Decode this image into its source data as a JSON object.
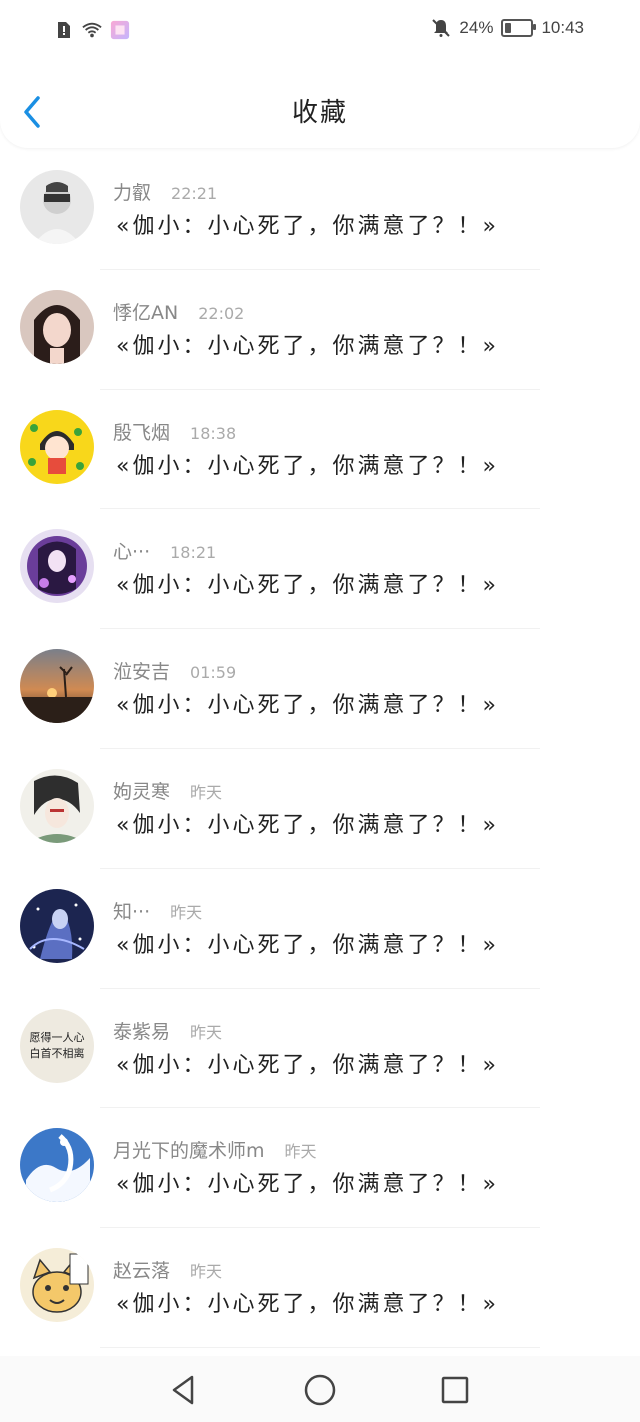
{
  "status_bar": {
    "battery_percent_text": "24%",
    "battery_level": 0.24,
    "time": "10:43",
    "icons": [
      "alert-icon",
      "wifi-icon",
      "app-icon",
      "mute-bell-icon",
      "battery-icon"
    ]
  },
  "header": {
    "title": "收藏",
    "back_icon": "chevron-left-icon"
  },
  "items": [
    {
      "name": "力叡",
      "time": "22:21",
      "message": "«伽小：小心死了，你满意了？！»",
      "avatar_theme": "bw-person"
    },
    {
      "name": "悸亿AN",
      "time": "22:02",
      "message": "«伽小：小心死了，你满意了？！»",
      "avatar_theme": "girl"
    },
    {
      "name": "殷飞烟",
      "time": "18:38",
      "message": "«伽小：小心死了，你满意了？！»",
      "avatar_theme": "yellow-cartoon"
    },
    {
      "name": "心···",
      "time": "18:21",
      "message": "«伽小：小心死了，你满意了？！»",
      "avatar_theme": "purple-anime"
    },
    {
      "name": "涖安吉",
      "time": "01:59",
      "message": "«伽小：小心死了，你满意了？！»",
      "avatar_theme": "sunset"
    },
    {
      "name": "姁灵寒",
      "time": "昨天",
      "message": "«伽小：小心死了，你满意了？！»",
      "avatar_theme": "ink-anime"
    },
    {
      "name": "知···",
      "time": "昨天",
      "message": "«伽小：小心死了，你满意了？！»",
      "avatar_theme": "blue-fantasy"
    },
    {
      "name": "泰紫易",
      "time": "昨天",
      "message": "«伽小：小心死了，你满意了？！»",
      "avatar_theme": "text-quote"
    },
    {
      "name": "月光下的魔术师m",
      "time": "昨天",
      "message": "«伽小：小心死了，你满意了？！»",
      "avatar_theme": "white-dragon"
    },
    {
      "name": "赵云落",
      "time": "昨天",
      "message": "«伽小：小心死了，你满意了？！»",
      "avatar_theme": "cat-cartoon"
    }
  ],
  "avatars": {
    "quote_line1": "愿得一人心",
    "quote_line2": "白首不相离"
  },
  "colors": {
    "accent": "#1a8fe3",
    "text_primary": "#222222",
    "text_secondary": "#888888",
    "text_time": "#aaaaaa"
  },
  "system_nav": {
    "back_icon": "triangle-back-icon",
    "home_icon": "circle-home-icon",
    "recent_icon": "square-recent-icon"
  }
}
